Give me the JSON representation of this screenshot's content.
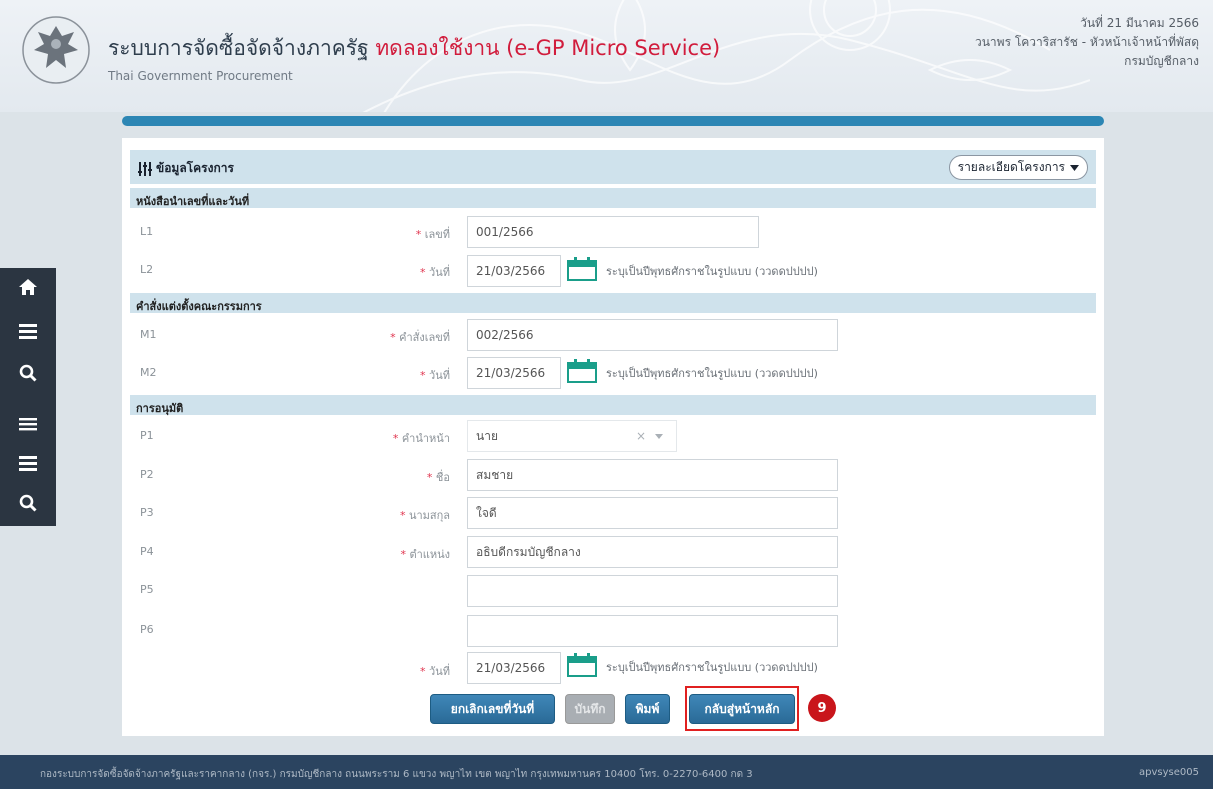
{
  "header": {
    "title_main": "ระบบการจัดซื้อจัดจ้างภาครัฐ",
    "title_trial": "ทดลองใช้งาน (e-GP Micro Service)",
    "title_sub": "Thai Government Procurement",
    "date": "วันที่ 21 มีนาคม 2566",
    "user": "วนาพร โควาริสารัช - หัวหน้าเจ้าหน้าที่พัสดุ",
    "org": "กรมบัญชีกลาง"
  },
  "sidebar": {
    "icons": [
      "home-icon",
      "menu-icon",
      "search-icon",
      "list-icon",
      "menu-icon",
      "search-icon"
    ]
  },
  "project": {
    "title": "ข้อมูลโครงการ",
    "detail_button": "รายละเอียดโครงการ"
  },
  "sections": {
    "letter": "หนังสือนำเลขที่และวันที่",
    "order": "คำสั่งแต่งตั้งคณะกรรมการ",
    "approval": "การอนุมัติ"
  },
  "rows": {
    "L1": {
      "code": "L1",
      "label": "เลขที่",
      "value": "001/2566"
    },
    "L2": {
      "code": "L2",
      "label": "วันที่",
      "value": "21/03/2566"
    },
    "M1": {
      "code": "M1",
      "label": "คำสั่งเลขที่",
      "value": "002/2566"
    },
    "M2": {
      "code": "M2",
      "label": "วันที่",
      "value": "21/03/2566"
    },
    "P1": {
      "code": "P1",
      "label": "คำนำหน้า",
      "value": "นาย"
    },
    "P2": {
      "code": "P2",
      "label": "ชื่อ",
      "value": "สมชาย"
    },
    "P3": {
      "code": "P3",
      "label": "นามสกุล",
      "value": "ใจดี"
    },
    "P4": {
      "code": "P4",
      "label": "ตำแหน่ง",
      "value": "อธิบดีกรมบัญชีกลาง"
    },
    "P5": {
      "code": "P5",
      "value": ""
    },
    "P6": {
      "code": "P6",
      "value": ""
    },
    "PD": {
      "label": "วันที่",
      "value": "21/03/2566"
    }
  },
  "date_hint": "ระบุเป็นปีพุทธศักราชในรูปแบบ (ววดดปปปป)",
  "select_clear": "×",
  "buttons": {
    "cancel_number_date": "ยกเลิกเลขที่วันที่",
    "save": "บันทึก",
    "print": "พิมพ์",
    "back_home": "กลับสู่หน้าหลัก"
  },
  "step_marker": "9",
  "footer": {
    "text": "กองระบบการจัดซื้อจัดจ้างภาครัฐและราคากลาง (กจร.) กรมบัญชีกลาง ถนนพระราม 6 แขวง พญาไท เขต พญาไท กรุงเทพมหานคร 10400 โทร. 0-2270-6400 กด 3",
    "user": "apvsyse005"
  }
}
